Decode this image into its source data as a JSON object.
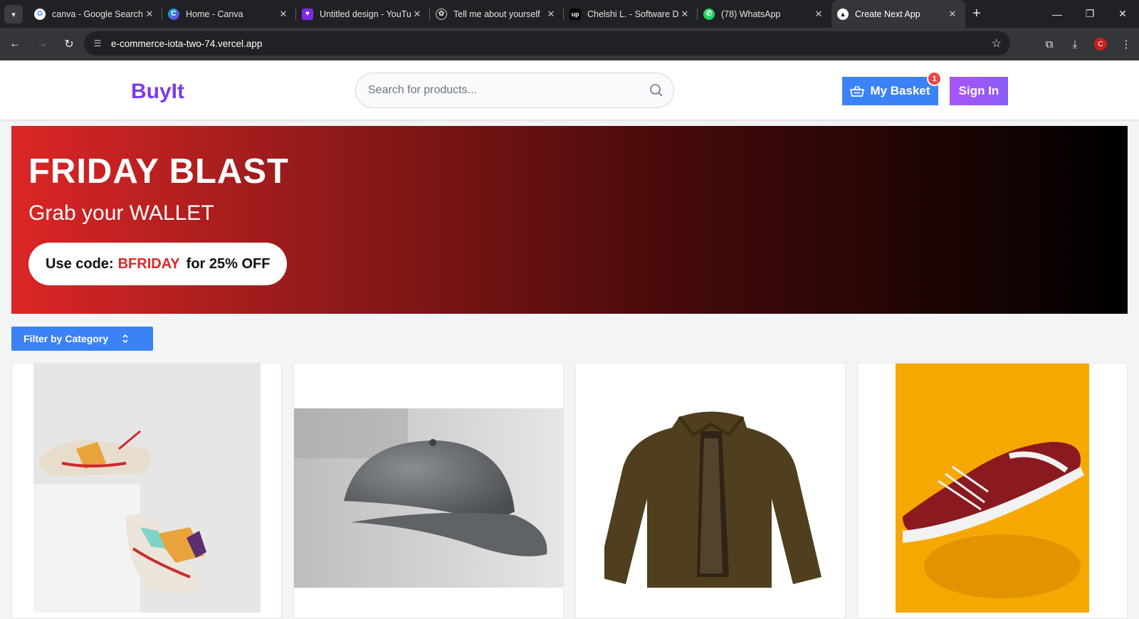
{
  "browser": {
    "tabs": [
      {
        "title": "canva - Google Search",
        "icon": "google-icon",
        "color": "#ffffff"
      },
      {
        "title": "Home - Canva",
        "icon": "canva-icon",
        "color": "#00c4cc"
      },
      {
        "title": "Untitled design - YouTube",
        "icon": "canva-heart-icon",
        "color": "#7d2ae8"
      },
      {
        "title": "Tell me about yourself",
        "icon": "chatgpt-icon",
        "color": "#cfcfcf"
      },
      {
        "title": "Chelshi L. - Software Developer",
        "icon": "upwork-icon",
        "color": "#000000"
      },
      {
        "title": "(78) WhatsApp",
        "icon": "whatsapp-icon",
        "color": "#25d366"
      },
      {
        "title": "Create Next App",
        "icon": "nextjs-icon",
        "color": "#ffffff",
        "active": true
      }
    ],
    "url": "e-commerce-iota-two-74.vercel.app",
    "profile_initial": "C"
  },
  "header": {
    "logo": "BuyIt",
    "search_placeholder": "Search for products...",
    "basket_label": "My Basket",
    "basket_count": "1",
    "signin_label": "Sign In",
    "colors": {
      "brand": "#7c3aed",
      "basket": "#3b82f6",
      "badge": "#ef4444"
    }
  },
  "banner": {
    "title": "FRIDAY BLAST",
    "subtitle": "Grab your WALLET",
    "promo_prefix": "Use code:",
    "promo_code": "BFRIDAY",
    "promo_suffix": "for 25% OFF",
    "colors": {
      "start": "#dc2626",
      "end": "#000000",
      "code": "#dc2626"
    }
  },
  "filter": {
    "label": "Filter by Category"
  },
  "products": [
    {
      "image": "sneakers-on-white-block",
      "bg": "#e6e6e6"
    },
    {
      "image": "grey-baseball-cap",
      "bg": "#ffffff"
    },
    {
      "image": "olive-leather-jacket",
      "bg": "#ffffff"
    },
    {
      "image": "maroon-sneaker-yellow-backdrop",
      "bg": "#f6a800"
    }
  ]
}
